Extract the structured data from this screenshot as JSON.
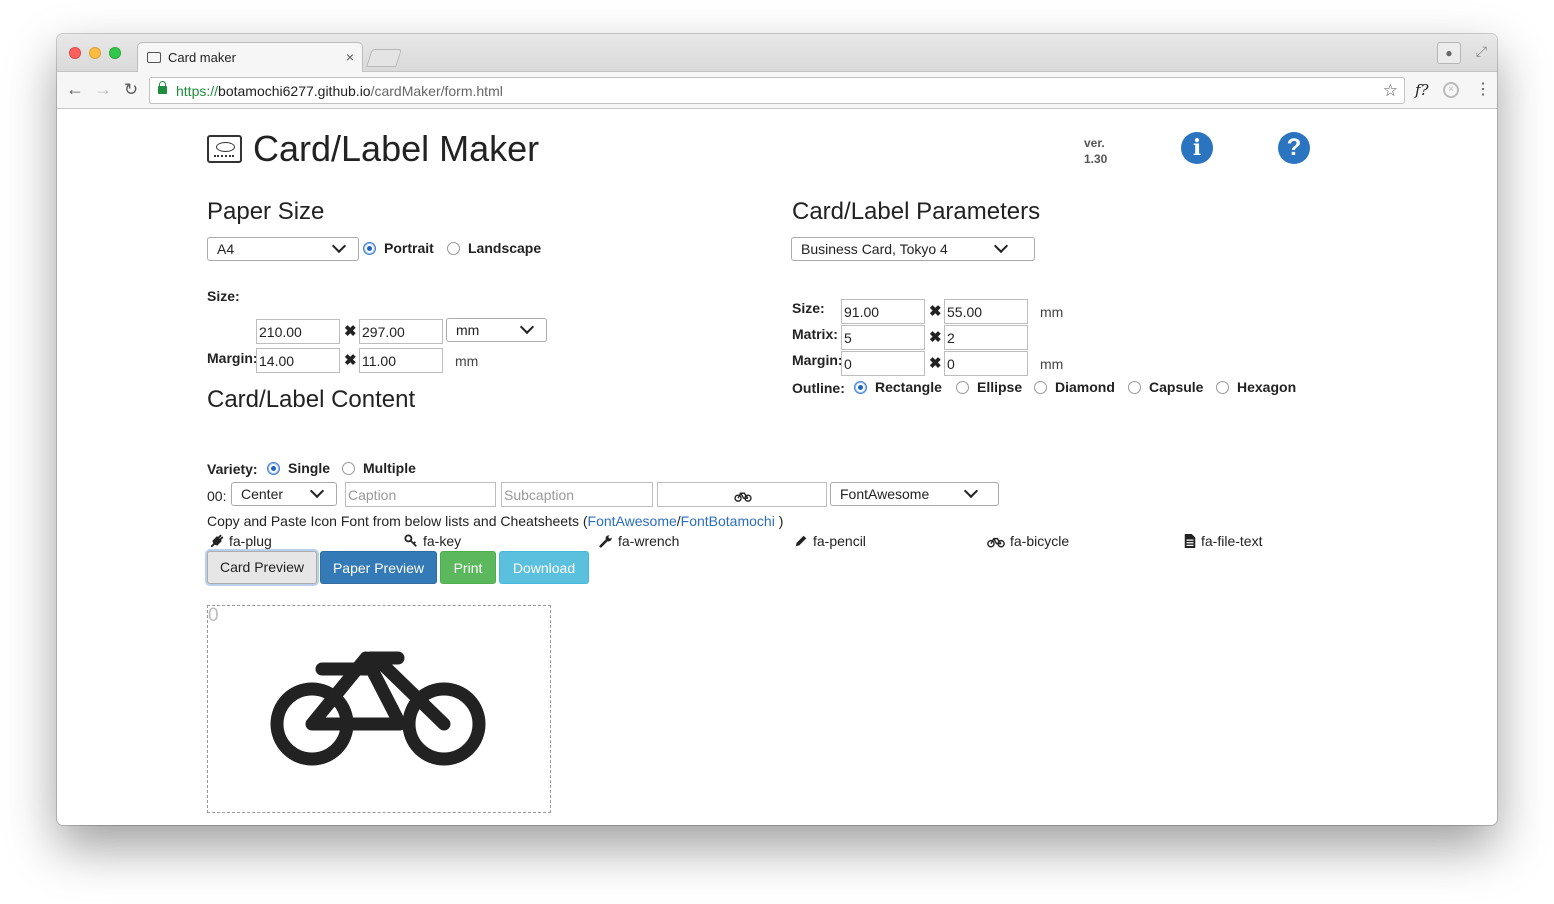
{
  "browser": {
    "tab_title": "Card maker",
    "tab_close": "×",
    "url_scheme": "https://",
    "url_host": "botamochi6277.github.io",
    "url_path": "/cardMaker/form.html",
    "ext_label": "f?"
  },
  "header": {
    "title": "Card/Label Maker",
    "version_label": "ver.",
    "version_number": "1.30",
    "info_glyph": "i",
    "help_glyph": "?"
  },
  "paper": {
    "heading": "Paper Size",
    "size_select": "A4",
    "orientation": {
      "portrait": "Portrait",
      "landscape": "Landscape",
      "selected": "Portrait"
    },
    "size_label": "Size:",
    "width": "210.00",
    "height": "297.00",
    "unit_select": "mm",
    "margin_label": "Margin:",
    "margin_x": "14.00",
    "margin_y": "11.00",
    "margin_unit": "mm"
  },
  "params": {
    "heading": "Card/Label Parameters",
    "preset": "Business Card, Tokyo 4",
    "size_label": "Size:",
    "width": "91.00",
    "height": "55.00",
    "size_unit": "mm",
    "matrix_label": "Matrix:",
    "matrix_x": "5",
    "matrix_y": "2",
    "margin_label": "Margin:",
    "margin_x": "0",
    "margin_y": "0",
    "margin_unit": "mm",
    "outline_label": "Outline:",
    "outlines": [
      "Rectangle",
      "Ellipse",
      "Diamond",
      "Capsule",
      "Hexagon"
    ],
    "outline_selected": "Rectangle"
  },
  "content": {
    "heading": "Card/Label Content",
    "variety_label": "Variety:",
    "variety_single": "Single",
    "variety_multiple": "Multiple",
    "variety_selected": "Single",
    "row_label": "00:",
    "align_select": "Center",
    "caption_placeholder": "Caption",
    "subcaption_placeholder": "Subcaption",
    "font_select": "FontAwesome",
    "help_text": "Copy and Paste Icon Font from below lists and Cheatsheets (",
    "link_fontawesome": "FontAwesome",
    "link_sep": "/",
    "link_fontbotamochi": "FontBotamochi",
    "help_close": " )",
    "icons": [
      {
        "name": "plug-icon",
        "label": "fa-plug"
      },
      {
        "name": "key-icon",
        "label": "fa-key"
      },
      {
        "name": "wrench-icon",
        "label": "fa-wrench"
      },
      {
        "name": "pencil-icon",
        "label": "fa-pencil"
      },
      {
        "name": "bicycle-icon",
        "label": "fa-bicycle"
      },
      {
        "name": "file-text-icon",
        "label": "fa-file-text"
      }
    ]
  },
  "actions": {
    "card_preview": "Card Preview",
    "paper_preview": "Paper Preview",
    "print": "Print",
    "download": "Download"
  },
  "preview": {
    "index": "0",
    "icon": "bicycle-icon"
  },
  "colors": {
    "primary": "#337ab7",
    "success": "#5cb85c",
    "info": "#5bc0de",
    "link": "#2a6ebf",
    "url_secure": "#1e8e3e"
  }
}
